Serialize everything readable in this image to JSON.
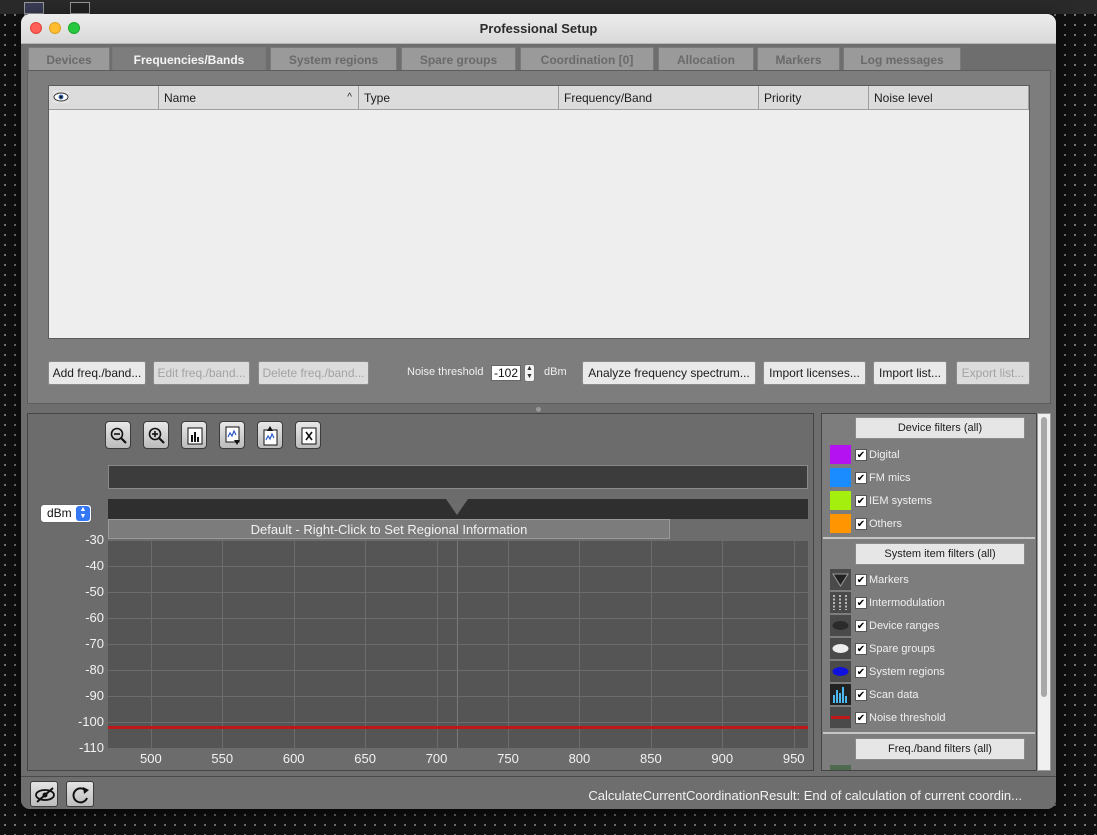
{
  "window": {
    "title": "Professional Setup"
  },
  "tabs": [
    {
      "label": "Devices"
    },
    {
      "label": "Frequencies/Bands"
    },
    {
      "label": "System regions"
    },
    {
      "label": "Spare groups"
    },
    {
      "label": "Coordination [0]"
    },
    {
      "label": "Allocation"
    },
    {
      "label": "Markers"
    },
    {
      "label": "Log messages"
    }
  ],
  "active_tab": "Frequencies/Bands",
  "table": {
    "columns": [
      "",
      "Name",
      "Type",
      "Frequency/Band",
      "Priority",
      "Noise level"
    ],
    "sort_indicator": "^",
    "rows": []
  },
  "actions": {
    "add": "Add freq./band...",
    "edit": "Edit freq./band...",
    "delete": "Delete freq./band...",
    "noise_label": "Noise threshold",
    "noise_value": "-102",
    "noise_unit": "dBm",
    "analyze": "Analyze frequency spectrum...",
    "import_licenses": "Import licenses...",
    "import_list": "Import list...",
    "export_list": "Export list..."
  },
  "toolbar": {
    "icons": [
      "zoom-out-icon",
      "zoom-in-icon",
      "bar-chart-icon",
      "export-scan-icon",
      "import-scan-icon",
      "clear-icon"
    ]
  },
  "spectrum": {
    "unit_select": "dBm",
    "region_label": "Default - Right-Click to Set Regional Information"
  },
  "chart_data": {
    "type": "line",
    "title": "",
    "xlabel": "",
    "ylabel": "",
    "xlim": [
      470,
      960
    ],
    "ylim": [
      -110,
      -30
    ],
    "x_ticks": [
      500,
      550,
      600,
      650,
      700,
      750,
      800,
      850,
      900,
      950
    ],
    "y_ticks": [
      -30,
      -40,
      -50,
      -60,
      -70,
      -80,
      -90,
      -100,
      -110
    ],
    "grid": true,
    "series": [
      {
        "name": "Noise threshold",
        "color": "#c01818",
        "x": [
          470,
          960
        ],
        "y": [
          -102,
          -102
        ]
      }
    ]
  },
  "filters": {
    "device_btn": "Device filters (all)",
    "device_items": [
      {
        "label": "Digital",
        "color": "#b412f0",
        "checked": true
      },
      {
        "label": "FM mics",
        "color": "#1a8cff",
        "checked": true
      },
      {
        "label": "IEM systems",
        "color": "#a4ef0e",
        "checked": true
      },
      {
        "label": "Others",
        "color": "#ff9500",
        "checked": true
      }
    ],
    "system_btn": "System item filters (all)",
    "system_items": [
      {
        "label": "Markers",
        "icon": "marker-icon",
        "checked": true
      },
      {
        "label": "Intermodulation",
        "icon": "intermod-icon",
        "checked": true
      },
      {
        "label": "Device ranges",
        "icon": "device-range-icon",
        "checked": true
      },
      {
        "label": "Spare groups",
        "icon": "spare-group-icon",
        "checked": true
      },
      {
        "label": "System regions",
        "icon": "system-region-icon",
        "checked": true
      },
      {
        "label": "Scan data",
        "icon": "scan-data-icon",
        "checked": true
      },
      {
        "label": "Noise threshold",
        "icon": "noise-threshold-icon",
        "checked": true
      }
    ],
    "freq_btn": "Freq./band filters (all)",
    "check_glyph": "✔"
  },
  "status": {
    "text": "CalculateCurrentCoordinationResult: End of calculation of current coordin..."
  }
}
